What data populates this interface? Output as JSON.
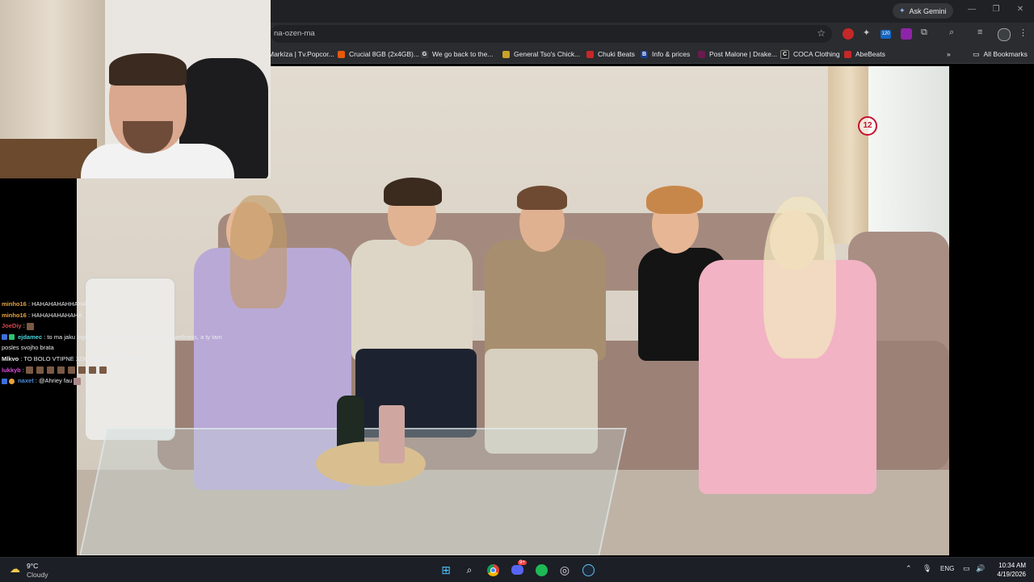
{
  "browser": {
    "ask_gemini": "Ask Gemini",
    "url_fragment": "na-ozen-ma",
    "extension_badge": "120",
    "bookmarks": [
      {
        "label": "Markíza | Tv.Popcor...",
        "color": "#5f6368"
      },
      {
        "label": "Crucial 8GB (2x4GB)...",
        "color": "#e8590c"
      },
      {
        "label": "We go back to the...",
        "color": "#3c4043",
        "glyph": "G"
      },
      {
        "label": "General Tso's Chick...",
        "color": "#c9a227"
      },
      {
        "label": "Chuki Beats",
        "color": "#c62828"
      },
      {
        "label": "Info & prices",
        "color": "#1a3d8f",
        "glyph": "B."
      },
      {
        "label": "Post Malone | Drake...",
        "color": "#6a1b4d"
      },
      {
        "label": "COCA Clothing",
        "color": "#222222",
        "glyph": "C"
      },
      {
        "label": "AbeBeats",
        "color": "#c62828"
      }
    ],
    "more_bookmarks": "»",
    "all_bookmarks": "All Bookmarks"
  },
  "video": {
    "channel_logo": "12"
  },
  "chat": {
    "messages": [
      {
        "user": "minho16",
        "color": "#e8a33d",
        "text": ": HAHAHAHAHHAHAHA"
      },
      {
        "user": "minho16",
        "color": "#e8a33d",
        "text": ": HAHAHAHAHAHA"
      },
      {
        "user": "JoeDiy",
        "color": "#d94a4a",
        "text": ":"
      },
      {
        "user": "ejdamec",
        "color": "#4ad0d9",
        "text": ": to ma jaku logiku ze s nou mas ist na rande do wellness, a ty tam posles svojho brata"
      },
      {
        "user": "Mlkvo",
        "color": "#e8eaed",
        "text": ": TO BOLO VTIPNE XDDDDDHAHAHAHAHAH"
      },
      {
        "user": "lukkyb",
        "color": "#d94ad9",
        "text": ":"
      },
      {
        "user": "naxet",
        "color": "#4a8cd9",
        "text": ": @Ahriey fau"
      }
    ]
  },
  "taskbar": {
    "temperature": "9°C",
    "condition": "Cloudy",
    "language": "ENG",
    "time": "10:34 AM",
    "date": "4/19/2026",
    "discord_badge": "9+"
  }
}
